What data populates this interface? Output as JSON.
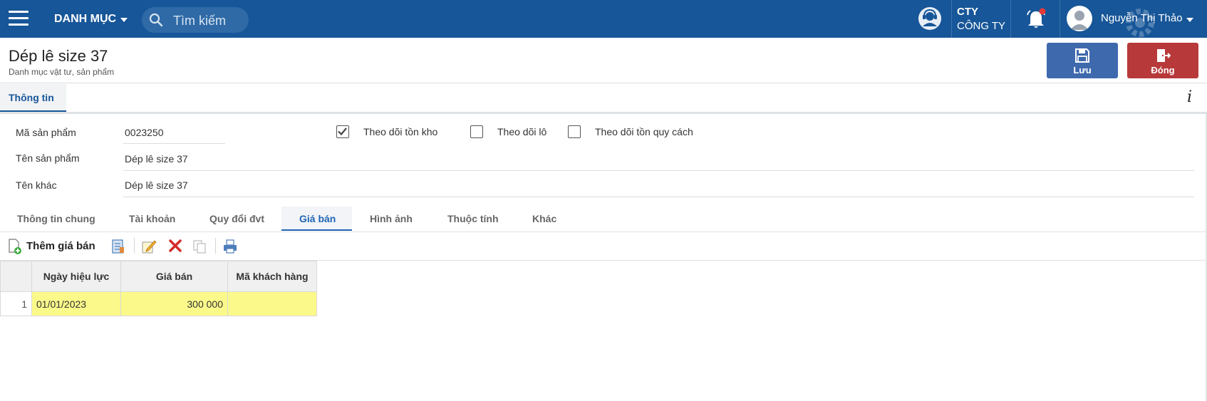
{
  "topbar": {
    "menu_title": "DANH MỤC",
    "search_placeholder": "Tìm kiếm",
    "company_line1": "CTY",
    "company_line2": "CÔNG TY",
    "username": "Nguyễn Thị Thảo",
    "brand_color": "#175698"
  },
  "header": {
    "title": "Dép lê size 37",
    "subtitle": "Danh mục vật tư, sản phẩm",
    "save_label": "Lưu",
    "close_label": "Đóng"
  },
  "main_tab": {
    "label": "Thông tin"
  },
  "form": {
    "product_code_label": "Mã sản phẩm",
    "product_code_value": "0023250",
    "product_name_label": "Tên sản phẩm",
    "product_name_value": "Dép lê size 37",
    "other_name_label": "Tên khác",
    "other_name_value": "Dép lê size 37",
    "checkboxes": [
      {
        "label": "Theo dõi tồn kho",
        "checked": true
      },
      {
        "label": "Theo dõi lô",
        "checked": false
      },
      {
        "label": "Theo dõi tồn quy cách",
        "checked": false
      }
    ]
  },
  "sub_tabs": [
    {
      "label": "Thông tin chung",
      "active": false
    },
    {
      "label": "Tài khoản",
      "active": false
    },
    {
      "label": "Quy đổi đvt",
      "active": false
    },
    {
      "label": "Giá bán",
      "active": true
    },
    {
      "label": "Hình ảnh",
      "active": false
    },
    {
      "label": "Thuộc tính",
      "active": false
    },
    {
      "label": "Khác",
      "active": false
    }
  ],
  "toolbar": {
    "add_label": "Thêm giá bán"
  },
  "grid": {
    "columns": [
      "Ngày hiệu lực",
      "Giá bán",
      "Mã khách hàng"
    ],
    "rows": [
      {
        "num": "1",
        "date": "01/01/2023",
        "price": "300 000",
        "customer": ""
      }
    ]
  }
}
